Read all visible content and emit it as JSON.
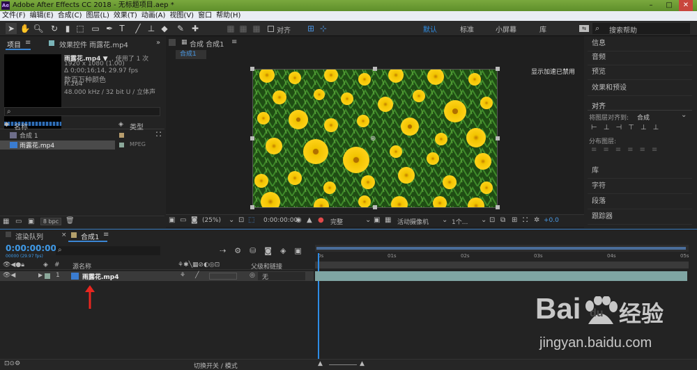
{
  "window": {
    "title": "Adobe After Effects CC 2018 - 无标题项目.aep *",
    "app_icon": "Ae"
  },
  "menu": [
    "文件(F)",
    "编辑(E)",
    "合成(C)",
    "图层(L)",
    "效果(T)",
    "动画(A)",
    "视图(V)",
    "窗口",
    "帮助(H)"
  ],
  "toolbar": {
    "snap_label": "对齐",
    "workspaces": [
      "默认",
      "标准",
      "小屏幕",
      "库"
    ],
    "search_placeholder": "搜索帮助"
  },
  "project": {
    "tab_project": "项目",
    "tab_effects": "效果控件 雨露花.mp4",
    "preview": {
      "name": "雨露花.mp4 ▼",
      "used": ", 使用了 1 次",
      "res": "1920 x 1080 (1.00)",
      "dur": "Δ 0;00;16;14, 29.97 fps",
      "color": "数百万种颜色",
      "codec": "H.264",
      "audio": "48.000 kHz / 32 bit U / 立体声"
    },
    "col_name": "名称",
    "col_type": "类型",
    "items": [
      {
        "name": "合成 1",
        "type": ""
      },
      {
        "name": "雨露花.mp4",
        "type": "MPEG"
      }
    ],
    "bpc": "8 bpc"
  },
  "viewer": {
    "tab": "合成 合成1",
    "subtab": "合成1",
    "gpu_note": "显示加速已禁用",
    "zoom": "(25%)",
    "time": "0:00:00:00",
    "quality": "完整",
    "camera": "活动摄像机",
    "views": "1个...",
    "exposure": "+0.0"
  },
  "right": {
    "items": [
      "信息",
      "音频",
      "预览",
      "效果和预设"
    ],
    "align_title": "对齐",
    "align_to_label": "将图层对齐到:",
    "align_to_value": "合成",
    "distribute_label": "分布图层:",
    "items2": [
      "库",
      "字符",
      "段落",
      "跟踪器"
    ]
  },
  "timeline": {
    "tab_render": "渲染队列",
    "tab_comp": "合成1",
    "timecode": "0:00:00:00",
    "frames": "00000 (29.97 fps)",
    "col_layer": "源名称",
    "col_parent": "父级和链接",
    "layer": {
      "num": "1",
      "name": "雨露花.mp4",
      "parent": "无"
    },
    "ruler": [
      "0s",
      "01s",
      "02s",
      "03s",
      "04s",
      "05s"
    ],
    "bottom_toggle": "切换开关 / 模式"
  },
  "watermark": {
    "text1": "Bai",
    "text2": "du",
    "text3": "经验",
    "url": "jingyan.baidu.com"
  }
}
